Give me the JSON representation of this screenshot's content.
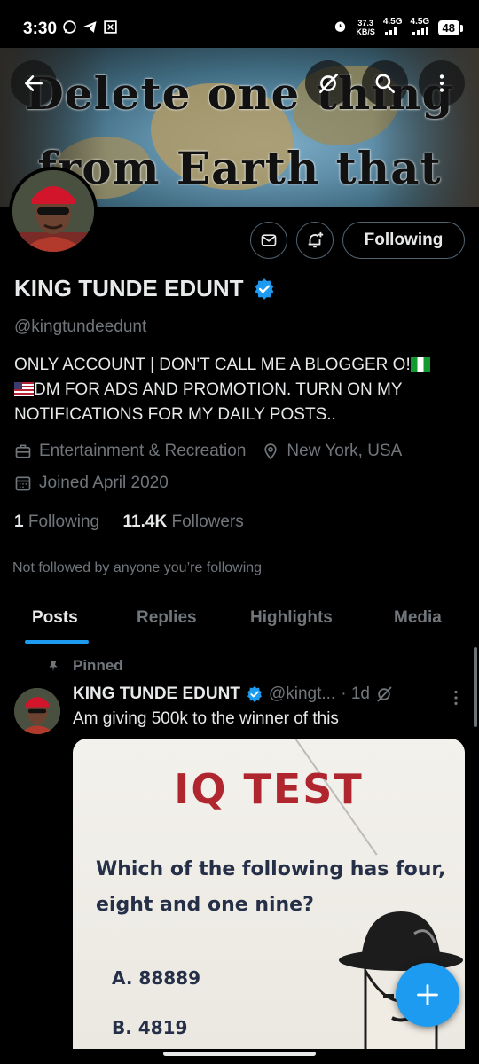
{
  "status_bar": {
    "time": "3:30",
    "left_icons": [
      "whatsapp-icon",
      "telegram-icon",
      "app-icon"
    ],
    "speed_value": "37.3",
    "speed_unit": "KB/S",
    "net1": "4.5G",
    "net2": "4.5G",
    "battery": "48"
  },
  "header": {
    "banner_line1": "Delete one thing",
    "banner_line2": "from Earth that",
    "buttons": [
      "back-arrow-icon",
      "grok-icon",
      "search-icon",
      "more-vertical-icon"
    ]
  },
  "profile": {
    "follow_label": "Following",
    "name": "KING TUNDE EDUNT",
    "handle": "@kingtundeedunt",
    "bio_part1": "ONLY ACCOUNT  | DON'T CALL ME A BLOGGER O!",
    "bio_part2": "DM FOR ADS AND PROMOTION.    TURN ON MY NOTIFICATIONS FOR MY DAILY POSTS..",
    "category": "Entertainment & Recreation",
    "location": "New York, USA",
    "joined": "Joined April 2020",
    "following_count": "1",
    "following_label": "Following",
    "followers_count": "11.4K",
    "followers_label": "Followers",
    "not_followed": "Not followed by anyone you’re following"
  },
  "tabs": [
    {
      "label": "Posts",
      "active": true
    },
    {
      "label": "Replies",
      "active": false
    },
    {
      "label": "Highlights",
      "active": false
    },
    {
      "label": "Media",
      "active": false
    }
  ],
  "post": {
    "pinned_label": "Pinned",
    "author_name": "KING TUNDE EDUNT",
    "author_handle": "@kingt...",
    "time": "· 1d",
    "text": "Am giving 500k to the winner of this",
    "media": {
      "title": "IQ TEST",
      "question": "Which of the following has four, eight and one nine?",
      "option_a": "A. 88889",
      "option_b": "B. 4819"
    }
  },
  "colors": {
    "accent": "#1d9bf0",
    "secondary_text": "#71767b",
    "border": "#536471",
    "iq_title": "#b0262f"
  }
}
